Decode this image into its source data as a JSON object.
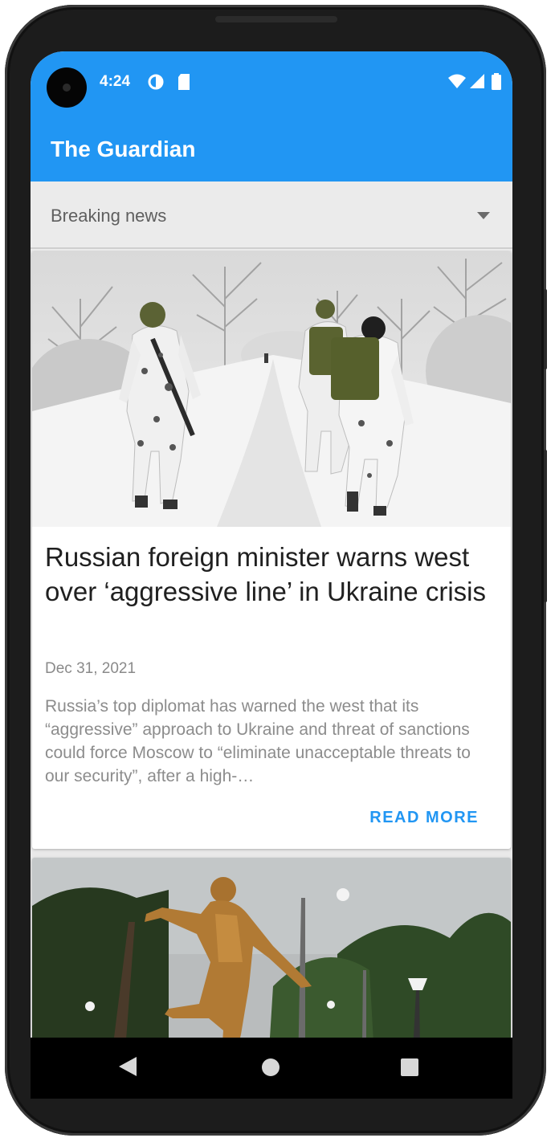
{
  "status_bar": {
    "time": "4:24",
    "icons": [
      "data-saver-icon",
      "sd-card-icon",
      "wifi-icon",
      "cell-signal-icon",
      "battery-icon"
    ]
  },
  "app_bar": {
    "title": "The Guardian",
    "color": "#2196f3"
  },
  "section_dropdown": {
    "selected": "Breaking news"
  },
  "articles": [
    {
      "image": "soldiers-in-snow-photo",
      "headline": "Russian foreign minister warns west over ‘aggressive line’ in Ukraine crisis",
      "date": "Dec 31, 2021",
      "snippet": "Russia’s top diplomat has warned the west that its “aggressive” approach to Ukraine and threat of sanctions could force Moscow to “eliminate unacceptable threats to our security”, after a high-…",
      "action_label": "READ MORE"
    },
    {
      "image": "bronze-footballer-statue-photo"
    }
  ],
  "nav_bar": {
    "buttons": [
      "back-icon",
      "home-icon",
      "recents-icon"
    ]
  },
  "colors": {
    "accent": "#2196f3",
    "background": "#ebebeb"
  }
}
